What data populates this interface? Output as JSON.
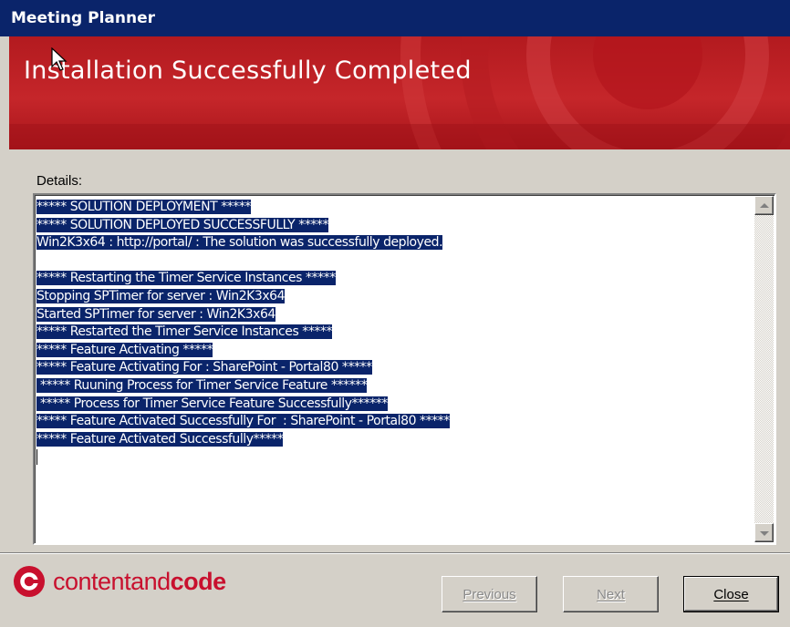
{
  "window": {
    "title": "Meeting Planner"
  },
  "banner": {
    "heading": "Installation Successfully Completed",
    "colors": {
      "primary": "#c5262a",
      "dark": "#a8141a"
    }
  },
  "details": {
    "label": "Details:",
    "lines": [
      "***** SOLUTION DEPLOYMENT *****",
      "***** SOLUTION DEPLOYED SUCCESSFULLY *****",
      "Win2K3x64 : http://portal/ : The solution was successfully deployed.",
      "",
      "***** Restarting the Timer Service Instances *****",
      "Stopping SPTimer for server : Win2K3x64",
      "Started SPTimer for server : Win2K3x64",
      "***** Restarted the Timer Service Instances *****",
      "***** Feature Activating *****",
      "***** Feature Activating For : SharePoint - Portal80 *****",
      " ***** Ruuning Process for Timer Service Feature ******",
      " ***** Process for Timer Service Feature Successfully******",
      "***** Feature Activated Successfully For  : SharePoint - Portal80 *****",
      "***** Feature Activated Successfully*****"
    ],
    "selection_color": "#0a246a"
  },
  "footer": {
    "logo": {
      "text_light": "contentand",
      "text_bold": "code",
      "color": "#c8102e"
    },
    "buttons": {
      "previous": "Previous",
      "next": "Next",
      "close": "Close"
    }
  }
}
